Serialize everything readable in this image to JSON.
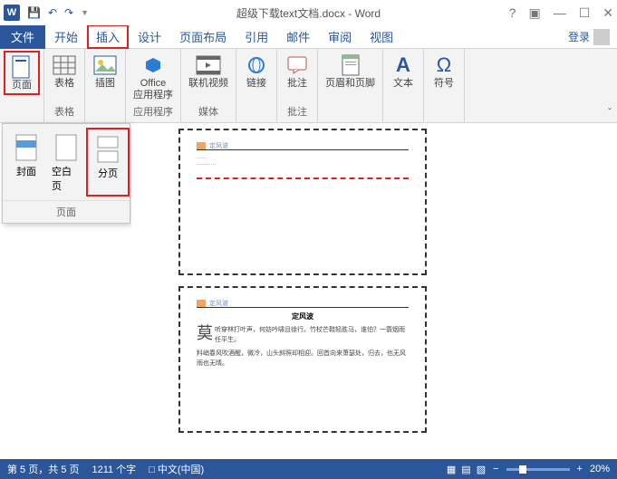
{
  "titlebar": {
    "title": "超级下载text文档.docx - Word"
  },
  "tabs": {
    "file": "文件",
    "home": "开始",
    "insert": "插入",
    "design": "设计",
    "layout": "页面布局",
    "ref": "引用",
    "mail": "邮件",
    "review": "审阅",
    "view": "视图",
    "login": "登录"
  },
  "ribbon": {
    "page": {
      "btn": "页面",
      "label": ""
    },
    "table": {
      "btn": "表格",
      "label": "表格"
    },
    "illus": {
      "btn": "插图"
    },
    "apps": {
      "btn": "Office\n应用程序",
      "label": "应用程序"
    },
    "video": {
      "btn": "联机视频",
      "label": "媒体"
    },
    "link": {
      "btn": "链接"
    },
    "comment": {
      "btn": "批注",
      "label": "批注"
    },
    "headfoot": {
      "btn": "页眉和页脚"
    },
    "text": {
      "btn": "文本"
    },
    "symbol": {
      "btn": "符号"
    }
  },
  "dropdown": {
    "cover": "封面",
    "blank": "空白页",
    "break": "分页",
    "label": "页面"
  },
  "doc": {
    "p1_h": "定风波",
    "p2_h": "定风波",
    "p2_title": "定风波",
    "p2_body1": "听穿林打叶声，何妨吟啸且徐行。竹杖芒鞋轻胜马，谁怕？一蓑烟雨任平生。",
    "p2_body2": "料峭春风吹酒醒，微冷，山头斜照却相迎。回首向来萧瑟处，归去，也无风雨也无晴。",
    "p2_drop": "莫"
  },
  "status": {
    "pages": "第 5 页，共 5 页",
    "words": "1211 个字",
    "lang": "中文(中国)",
    "zoom": "20%"
  }
}
